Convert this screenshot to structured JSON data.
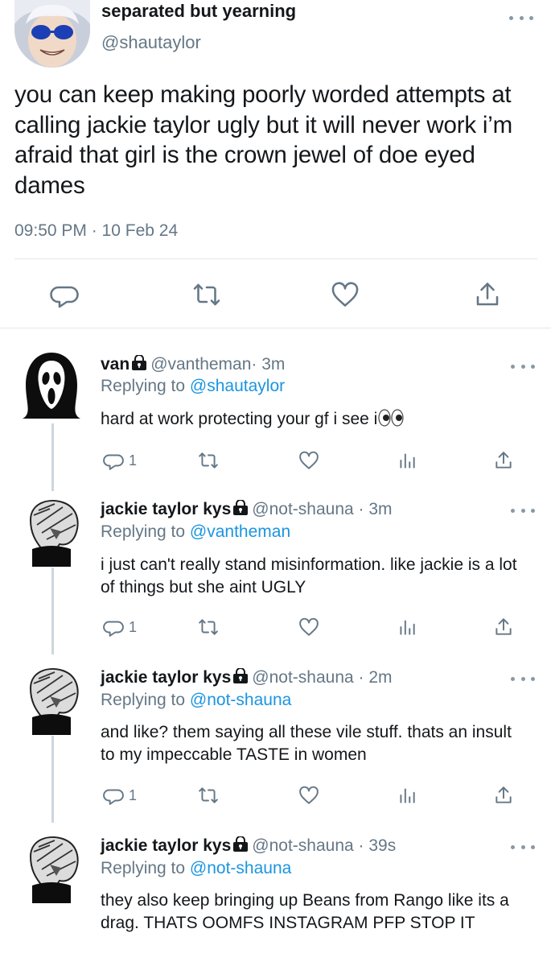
{
  "main_tweet": {
    "display_name": "separated but yearning",
    "handle": "@shautaylor",
    "text": "you can keep making poorly worded attempts at calling jackie taylor ugly but it will never work i’m afraid that girl is the crown jewel of doe eyed dames",
    "timestamp": "09:50 PM · 10 Feb 24",
    "icons": [
      "reply-icon",
      "retweet-icon",
      "like-icon",
      "share-icon"
    ]
  },
  "replies": [
    {
      "name": "van",
      "handle": "@vantheman",
      "time": "· 3m",
      "replying_label": "Replying to",
      "replying_to": "@shautaylor",
      "text": "hard at work protecting your gf i see i",
      "reply_count": "1",
      "avatar": "ghostface-avatar"
    },
    {
      "name": "jackie taylor kys",
      "handle": "@not-shauna",
      "time": "· 3m",
      "replying_label": "Replying to",
      "replying_to": "@vantheman",
      "text": "i just can't really stand misinformation. like jackie is a lot of things but she aint UGLY",
      "reply_count": "1",
      "avatar": "sketch-avatar"
    },
    {
      "name": "jackie taylor kys",
      "handle": "@not-shauna",
      "time": "· 2m",
      "replying_label": "Replying to",
      "replying_to": "@not-shauna",
      "text": "and like? them saying all these vile stuff. thats an insult to my impeccable TASTE in women",
      "reply_count": "1",
      "avatar": "sketch-avatar"
    },
    {
      "name": "jackie taylor kys",
      "handle": "@not-shauna",
      "time": "· 39s",
      "replying_label": "Replying to",
      "replying_to": "@not-shauna",
      "text": "they also keep bringing up Beans from Rango like its a drag. THATS OOMFS INSTAGRAM PFP STOP IT",
      "avatar": "sketch-avatar"
    }
  ],
  "colors": {
    "link": "#1b95e0",
    "secondary_text": "#657786",
    "icon": "#657786",
    "divider": "#e1e8ed"
  }
}
